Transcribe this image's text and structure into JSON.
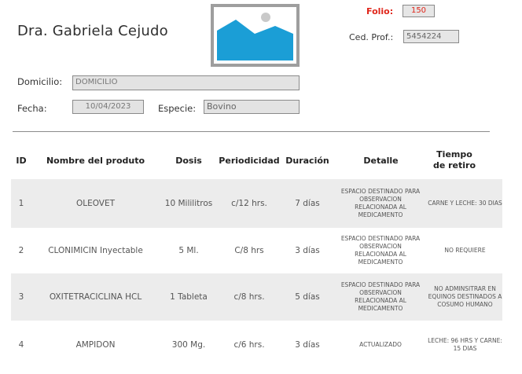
{
  "header": {
    "doctor_name": "Dra. Gabriela Cejudo",
    "folio_label": "Folio:",
    "folio_value": "150",
    "ced_label": "Ced. Prof.:",
    "ced_value": "5454224"
  },
  "logo_icon": "image-placeholder-icon",
  "form": {
    "domicilio_label": "Domicilio:",
    "domicilio_value": "DOMICILIO",
    "fecha_label": "Fecha:",
    "fecha_value": "10/04/2023",
    "especie_label": "Especie:",
    "especie_value": "Bovino"
  },
  "table": {
    "columns": [
      "ID",
      "Nombre del produto",
      "Dosis",
      "Periodicidad",
      "Duración",
      "Detalle",
      "Tiempo de retiro"
    ],
    "rows": [
      {
        "id": "1",
        "nombre": "OLEOVET",
        "dosis": "10 Mililitros",
        "periodicidad": "c/12 hrs.",
        "duracion": "7 días",
        "detalle": "ESPACIO DESTINADO PARA OBSERVACION RELACIONADA AL MEDICAMENTO",
        "retiro": "CARNE Y LECHE: 30 DIAS"
      },
      {
        "id": "2",
        "nombre": "CLONIMICIN Inyectable",
        "dosis": "5 Ml.",
        "periodicidad": "C/8 hrs",
        "duracion": "3 días",
        "detalle": "ESPACIO DESTINADO PARA OBSERVACION RELACIONADA AL MEDICAMENTO",
        "retiro": "NO REQUIERE"
      },
      {
        "id": "3",
        "nombre": "OXITETRACICLINA HCL",
        "dosis": "1 Tableta",
        "periodicidad": "c/8 hrs.",
        "duracion": "5 días",
        "detalle": "ESPACIO DESTINADO PARA OBSERVACION RELACIONADA AL MEDICAMENTO",
        "retiro": "NO ADMINSITRAR EN EQUINOS DESTINADOS A COSUMO HUMANO"
      },
      {
        "id": "4",
        "nombre": "AMPIDON",
        "dosis": "300 Mg.",
        "periodicidad": "c/6 hrs.",
        "duracion": "3 días",
        "detalle": "ACTUALIZADO",
        "retiro": "LECHE: 96 HRS Y CARNE: 15 DIAS"
      }
    ]
  },
  "colors": {
    "folio_red": "#e0261b",
    "logo_blue": "#1b9ed6",
    "logo_frame": "#9e9e9e",
    "row_shade": "#ececec",
    "field_bg": "#e3e3e3"
  }
}
